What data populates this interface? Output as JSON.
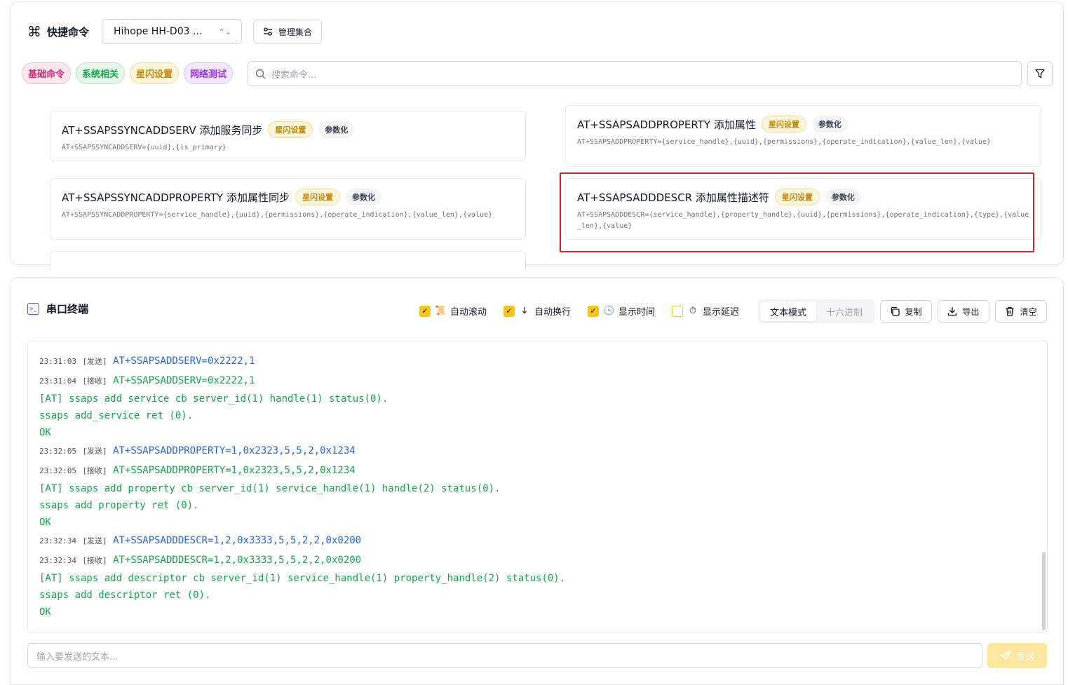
{
  "quick_commands": {
    "title": "快捷命令",
    "device": "Hihope HH-D03 ...",
    "manage_label": "管理集合",
    "search_placeholder": "搜索命令...",
    "tags": [
      "基础命令",
      "系统相关",
      "星闪设置",
      "网络测试"
    ],
    "cards": [
      {
        "title": "AT+SSAPSSYNCADDSERV 添加服务同步",
        "badge": "星闪设置",
        "param": "参数化",
        "syntax": "AT+SSAPSSYNCADDSERV={uuid},{is_primary}"
      },
      {
        "title": "AT+SSAPSADDPROPERTY 添加属性",
        "badge": "星闪设置",
        "param": "参数化",
        "syntax": "AT+SSAPSADDPROPERTY={service_handle},{uuid},{permissions},{operate_indication},{value_len},{value}"
      },
      {
        "title": "AT+SSAPSSYNCADDPROPERTY 添加属性同步",
        "badge": "星闪设置",
        "param": "参数化",
        "syntax": "AT+SSAPSSYNCADDPROPERTY={service_handle},{uuid},{permissions},{operate_indication},{value_len},{value}"
      },
      {
        "title": "AT+SSAPSADDDESCR 添加属性描述符",
        "badge": "星闪设置",
        "param": "参数化",
        "syntax": "AT+SSAPSADDDESCR={service_handle},{property_handle},{uuid},{permissions},{operate_indication},{type},{value_len},{value}"
      }
    ]
  },
  "terminal": {
    "title": "串口终端",
    "options": {
      "auto_scroll": "自动滚动",
      "auto_wrap": "自动换行",
      "show_time": "显示时间",
      "show_delay": "显示延迟"
    },
    "modes": {
      "text": "文本模式",
      "hex": "十六进制"
    },
    "actions": {
      "copy": "复制",
      "export": "导出",
      "clear": "清空"
    },
    "input_placeholder": "输入要发送的文本...",
    "send_label": "发送",
    "log": [
      {
        "kind": "meta",
        "time": "23:31:03",
        "tag": "[发送]",
        "text": "AT+SSAPSADDSERV=0x2222,1",
        "dir": "tx"
      },
      {
        "kind": "meta",
        "time": "23:31:04",
        "tag": "[接收]",
        "text": "AT+SSAPSADDSERV=0x2222,1",
        "dir": "rx"
      },
      {
        "kind": "out",
        "text": "[AT] ssaps add service cb server_id(1) handle(1) status(0)."
      },
      {
        "kind": "out",
        "text": "ssaps add_service ret (0)."
      },
      {
        "kind": "out",
        "text": "OK"
      },
      {
        "kind": "meta",
        "time": "23:32:05",
        "tag": "[发送]",
        "text": "AT+SSAPSADDPROPERTY=1,0x2323,5,5,2,0x1234",
        "dir": "tx"
      },
      {
        "kind": "meta",
        "time": "23:32:05",
        "tag": "[接收]",
        "text": "AT+SSAPSADDPROPERTY=1,0x2323,5,5,2,0x1234",
        "dir": "rx"
      },
      {
        "kind": "out",
        "text": "[AT] ssaps add property cb server_id(1) service_handle(1) handle(2) status(0)."
      },
      {
        "kind": "out",
        "text": "ssaps add property ret (0)."
      },
      {
        "kind": "out",
        "text": "OK"
      },
      {
        "kind": "meta",
        "time": "23:32:34",
        "tag": "[发送]",
        "text": "AT+SSAPSADDDESCR=1,2,0x3333,5,5,2,2,0x0200",
        "dir": "tx"
      },
      {
        "kind": "meta",
        "time": "23:32:34",
        "tag": "[接收]",
        "text": "AT+SSAPSADDDESCR=1,2,0x3333,5,5,2,2,0x0200",
        "dir": "rx"
      },
      {
        "kind": "out",
        "text": "[AT] ssaps add descriptor cb server_id(1) service_handle(1) property_handle(2) status(0)."
      },
      {
        "kind": "out",
        "text": "ssaps add descriptor ret (0)."
      },
      {
        "kind": "out",
        "text": "OK"
      }
    ]
  }
}
